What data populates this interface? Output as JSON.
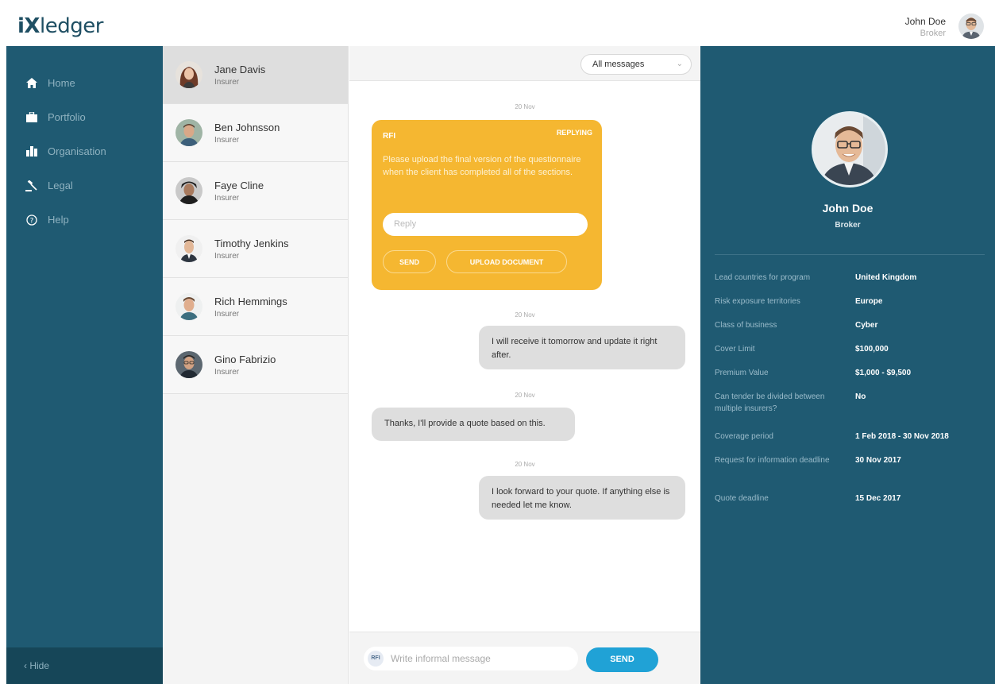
{
  "header": {
    "logo": {
      "i": "i",
      "x": "X",
      "rest": "ledger"
    },
    "user": {
      "name": "John Doe",
      "role": "Broker"
    }
  },
  "nav": {
    "items": [
      {
        "label": "Home",
        "icon": "home-icon"
      },
      {
        "label": "Portfolio",
        "icon": "briefcase-icon"
      },
      {
        "label": "Organisation",
        "icon": "buildings-icon"
      },
      {
        "label": "Legal",
        "icon": "gavel-icon"
      },
      {
        "label": "Help",
        "icon": "help-icon"
      }
    ],
    "hide_label": "‹  Hide"
  },
  "contacts": [
    {
      "name": "Jane Davis",
      "role": "Insurer"
    },
    {
      "name": "Ben Johnsson",
      "role": "Insurer"
    },
    {
      "name": "Faye Cline",
      "role": "Insurer"
    },
    {
      "name": "Timothy Jenkins",
      "role": "Insurer"
    },
    {
      "name": "Rich Hemmings",
      "role": "Insurer"
    },
    {
      "name": "Gino Fabrizio",
      "role": "Insurer"
    }
  ],
  "chat": {
    "filter": "All messages",
    "dates": [
      "20 Nov",
      "20 Nov",
      "20 Nov",
      "20 Nov"
    ],
    "rfi": {
      "tag": "RFI",
      "status": "REPLYING",
      "message": "Please upload the final version of the questionnaire when the client has completed all of the sections.",
      "reply_placeholder": "Reply",
      "send_label": "SEND",
      "upload_label": "UPLOAD DOCUMENT"
    },
    "messages": [
      {
        "text": "I will receive it tomorrow and update it right after."
      },
      {
        "text": "Thanks, I'll provide a quote based on this."
      },
      {
        "text": "I look forward to your quote. If anything else is needed let me know."
      }
    ],
    "composer": {
      "badge": "RFI",
      "placeholder": "Write informal message",
      "send_label": "SEND"
    }
  },
  "profile": {
    "name": "John Doe",
    "role": "Broker",
    "details": [
      {
        "key": "Lead countries for program",
        "value": "United Kingdom"
      },
      {
        "key": "Risk exposure territories",
        "value": "Europe"
      },
      {
        "key": "Class of business",
        "value": "Cyber"
      },
      {
        "key": "Cover Limit",
        "value": "$100,000"
      },
      {
        "key": "Premium Value",
        "value": "$1,000 - $9,500"
      },
      {
        "key": "Can tender be divided between multiple insurers?",
        "value": "No"
      },
      {
        "key": "Coverage period",
        "value": "1 Feb 2018 - 30 Nov 2018"
      },
      {
        "key": "Request for information deadline",
        "value": "30 Nov 2017"
      },
      {
        "key": "Quote deadline",
        "value": "15 Dec 2017"
      }
    ]
  },
  "colors": {
    "sidebar": "#1f5a72",
    "rfi": "#f5b731",
    "send": "#20a2d6"
  }
}
